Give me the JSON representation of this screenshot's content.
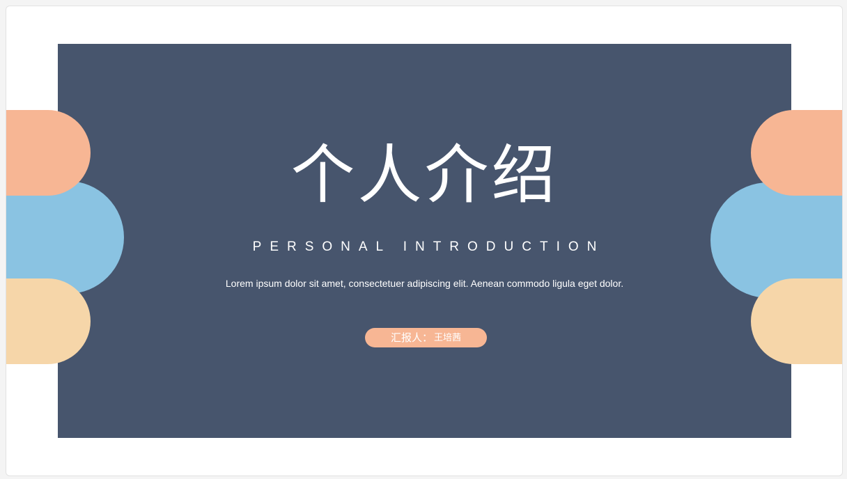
{
  "slide": {
    "title": "个人介绍",
    "subtitle": "PERSONAL INTRODUCTION",
    "description": "Lorem ipsum dolor sit amet, consectetuer adipiscing elit. Aenean commodo ligula eget dolor.",
    "reporter_label": "汇报人：",
    "reporter_name": "王培茜"
  },
  "colors": {
    "background": "#47556d",
    "peach": "#f7b694",
    "blue": "#8ac3e2",
    "cream": "#f6d6a9",
    "text": "#ffffff"
  }
}
